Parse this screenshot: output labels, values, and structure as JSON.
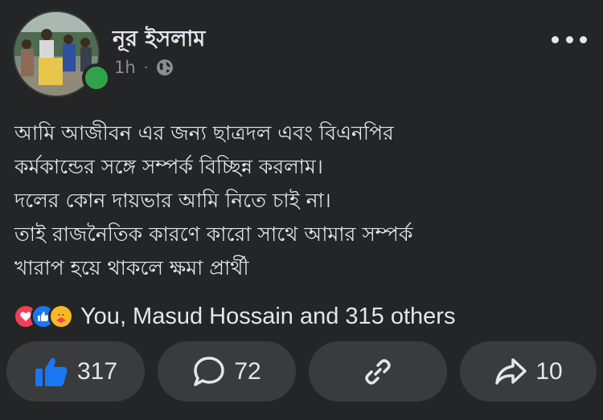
{
  "post": {
    "author_name": "নূর ইসলাম",
    "time": "1h",
    "separator": "·",
    "privacy_icon": "globe-icon",
    "text": "আমি আজীবন এর জন্য ছাত্রদল এবং বিএনপির\nকর্মকান্ডের সঙ্গে সম্পর্ক বিচ্ছিন্ন করলাম।\nদলের কোন দায়ভার আমি নিতে চাই না।\nতাই রাজনৈতিক কারণে কারো সাথে আমার সম্পর্ক\nখারাপ হয়ে থাকলে ক্ষমা প্রার্থী"
  },
  "reactions": {
    "icons": [
      "love-icon",
      "like-icon",
      "care-icon"
    ],
    "summary": "You, Masud Hossain and 315 others"
  },
  "actions": {
    "like_count": "317",
    "comment_count": "72",
    "share_count": "10"
  },
  "colors": {
    "background": "#242526",
    "button_bg": "#3a3b3c",
    "like_blue": "#1877f2",
    "online_green": "#31a24c",
    "text": "#e4e6eb",
    "muted": "#8a8d91"
  }
}
